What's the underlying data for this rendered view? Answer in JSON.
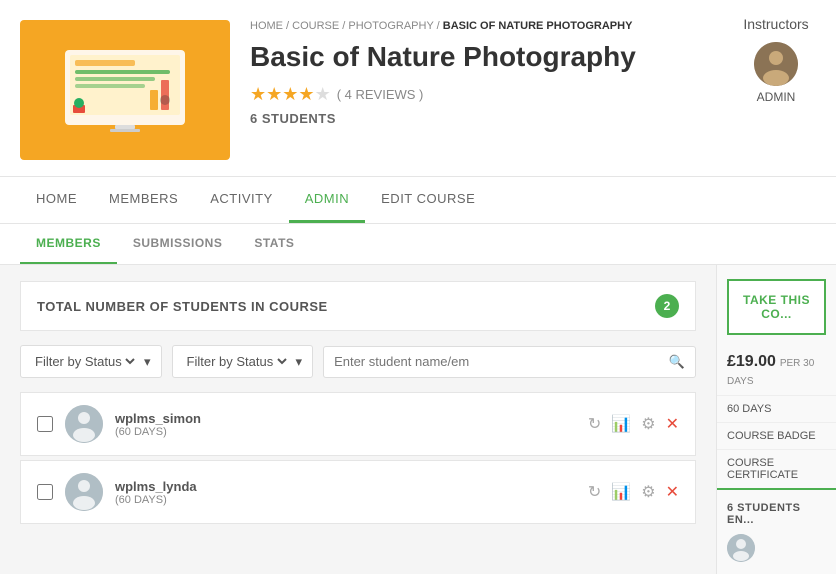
{
  "breadcrumb": {
    "home": "HOME",
    "sep1": "/",
    "course": "COURSE",
    "sep2": "/",
    "photography": "PHOTOGRAPHY",
    "sep3": "/",
    "current": "BASIC OF NATURE PHOTOGRAPHY"
  },
  "course": {
    "title": "Basic of Nature Photography",
    "reviews_count": "( 4 REVIEWS )",
    "students_count": "6 STUDENTS",
    "stars": 4.5
  },
  "instructors": {
    "label": "Instructors",
    "admin_name": "ADMIN"
  },
  "nav_tabs": [
    {
      "id": "home",
      "label": "HOME"
    },
    {
      "id": "members",
      "label": "MEMBERS"
    },
    {
      "id": "activity",
      "label": "ACTIVITY"
    },
    {
      "id": "admin",
      "label": "ADMIN",
      "active": true
    },
    {
      "id": "edit-course",
      "label": "EDIT COURSE"
    }
  ],
  "sub_tabs": [
    {
      "id": "members",
      "label": "MEMBERS",
      "active": true
    },
    {
      "id": "submissions",
      "label": "SUBMISSIONS"
    },
    {
      "id": "stats",
      "label": "STATS"
    }
  ],
  "students_section": {
    "total_label": "TOTAL NUMBER OF STUDENTS IN COURSE",
    "total_count": "2",
    "filter1_placeholder": "Filter by Status",
    "filter2_placeholder": "Filter by Status",
    "search_placeholder": "Enter student name/em"
  },
  "students": [
    {
      "name": "wplms_simon",
      "duration": "60 DAYS"
    },
    {
      "name": "wplms_lynda",
      "duration": "60 DAYS"
    }
  ],
  "sidebar": {
    "take_course_label": "TAKE THIS CO...",
    "price": "£19.00",
    "price_period": "PER 30 DAYS",
    "items": [
      "60 DAYS",
      "COURSE BADGE",
      "COURSE CERTIFICATE"
    ],
    "enrolled_label": "6 STUDENTS EN..."
  },
  "colors": {
    "accent_green": "#4caf50",
    "star_color": "#f5a623",
    "thumbnail_bg": "#f5a623"
  }
}
